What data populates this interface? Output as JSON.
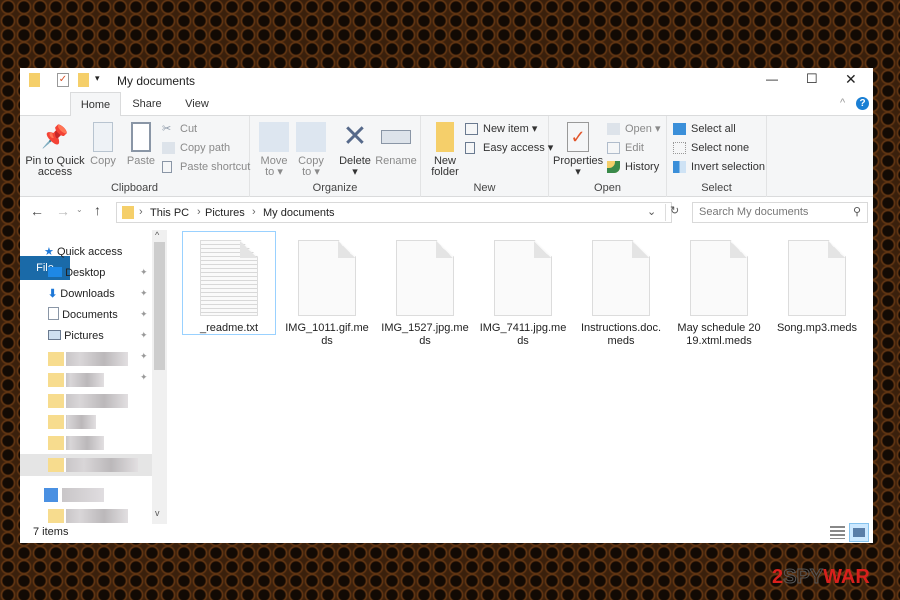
{
  "window": {
    "title": "My documents",
    "minimize": "—",
    "maximize": "☐",
    "close": "✕",
    "help": "?"
  },
  "tabs": [
    "File",
    "Home",
    "Share",
    "View"
  ],
  "ribbon": {
    "clipboard": {
      "label": "Clipboard",
      "pin": "Pin to Quick access",
      "copy": "Copy",
      "paste": "Paste",
      "cut": "Cut",
      "copy_path": "Copy path",
      "paste_shortcut": "Paste shortcut"
    },
    "organize": {
      "label": "Organize",
      "move_to": "Move to",
      "copy_to": "Copy to",
      "delete": "Delete",
      "rename": "Rename"
    },
    "new": {
      "label": "New",
      "new_folder": "New folder",
      "new_item": "New item",
      "easy_access": "Easy access"
    },
    "open": {
      "label": "Open",
      "properties": "Properties",
      "open": "Open",
      "edit": "Edit",
      "history": "History"
    },
    "select": {
      "label": "Select",
      "select_all": "Select all",
      "select_none": "Select none",
      "invert": "Invert selection"
    }
  },
  "address": {
    "path": [
      "This PC",
      "Pictures",
      "My documents"
    ],
    "search_placeholder": "Search My documents"
  },
  "nav": {
    "quick_access": "Quick access",
    "items": [
      "Desktop",
      "Downloads",
      "Documents",
      "Pictures"
    ]
  },
  "files": [
    {
      "name": "_readme.txt",
      "type": "text",
      "selected": true
    },
    {
      "name": "IMG_1011.gif.meds",
      "type": "blank"
    },
    {
      "name": "IMG_1527.jpg.meds",
      "type": "blank"
    },
    {
      "name": "IMG_7411.jpg.meds",
      "type": "blank"
    },
    {
      "name": "Instructions.doc.meds",
      "type": "blank"
    },
    {
      "name": "May schedule 2019.xtml.meds",
      "type": "blank"
    },
    {
      "name": "Song.mp3.meds",
      "type": "blank"
    }
  ],
  "status": {
    "items": "7 items"
  },
  "watermark": "2SPYWAR",
  "colors": {
    "accent": "#1a6aa8",
    "selection": "#cce8ff"
  }
}
